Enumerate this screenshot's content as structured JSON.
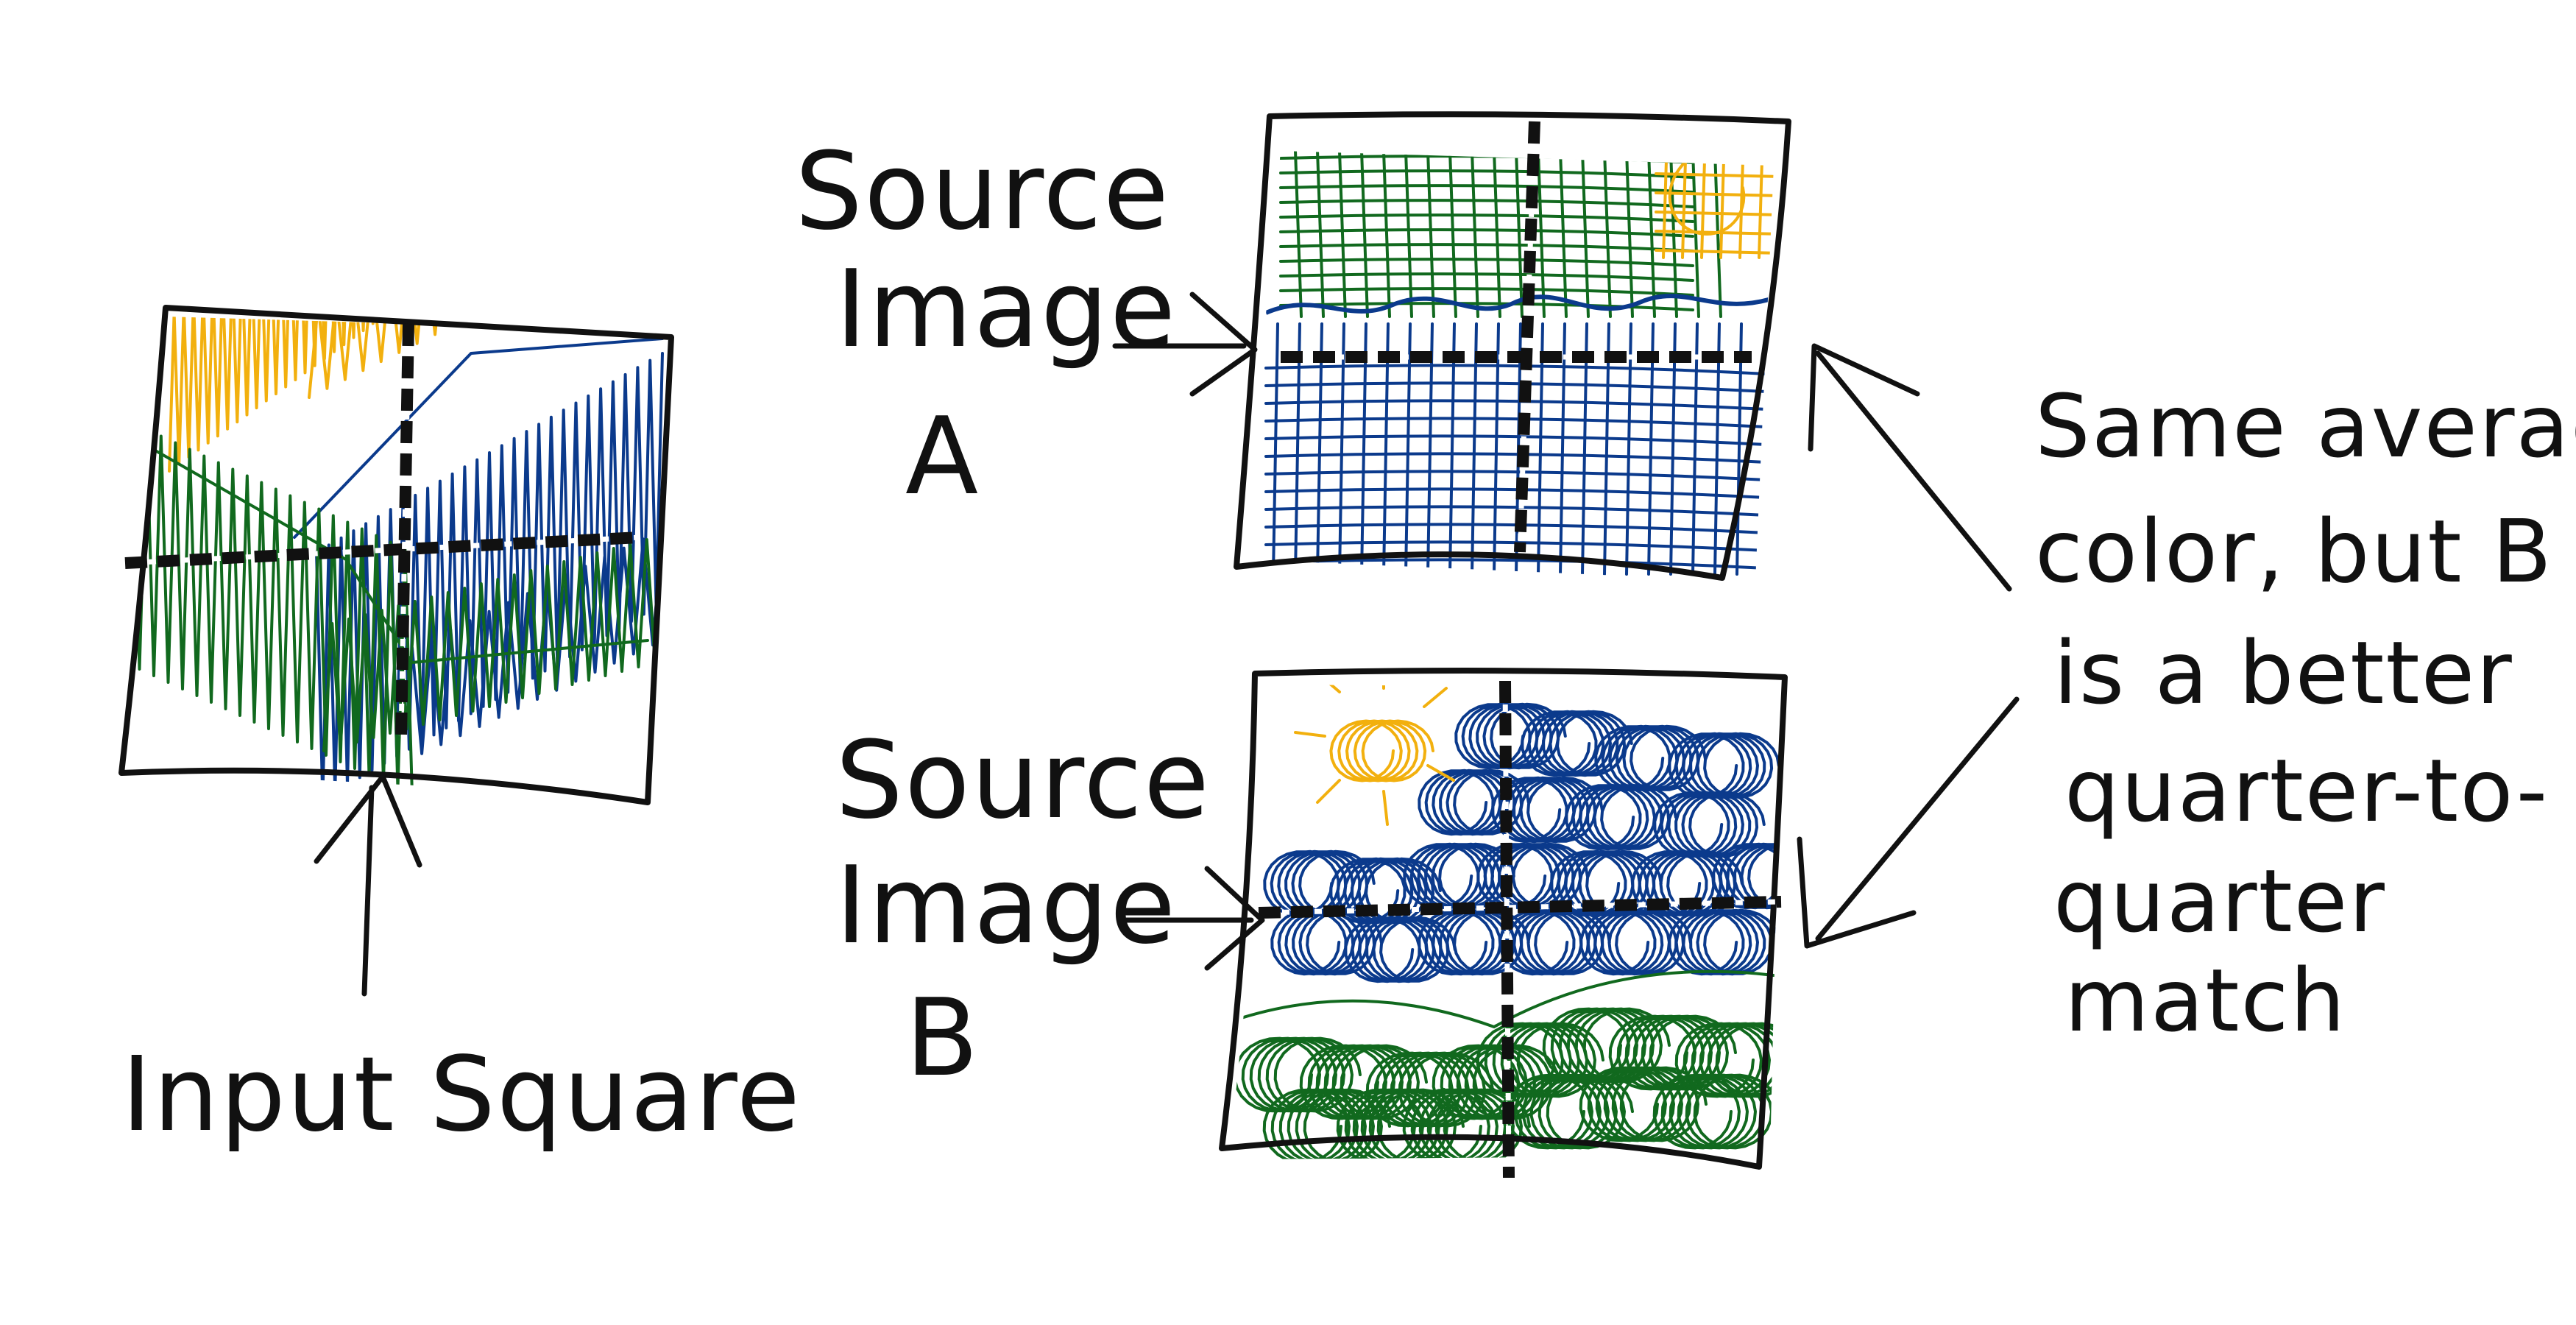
{
  "colors": {
    "ink": "#111111",
    "yellow": "#f2b00e",
    "blue": "#0b3a8c",
    "green": "#11691e",
    "paper": "#ffffff"
  },
  "labels": {
    "input_square": "Input Square",
    "source_a_line1": "Source",
    "source_a_line2": "Image",
    "source_a_line3": "A",
    "source_b_line1": "Source",
    "source_b_line2": "Image",
    "source_b_line3": "B",
    "note_line1": "Same average",
    "note_line2": "color, but B",
    "note_line3": "is a better",
    "note_line4": "quarter-to-",
    "note_line5": "quarter",
    "note_line6": "match"
  }
}
